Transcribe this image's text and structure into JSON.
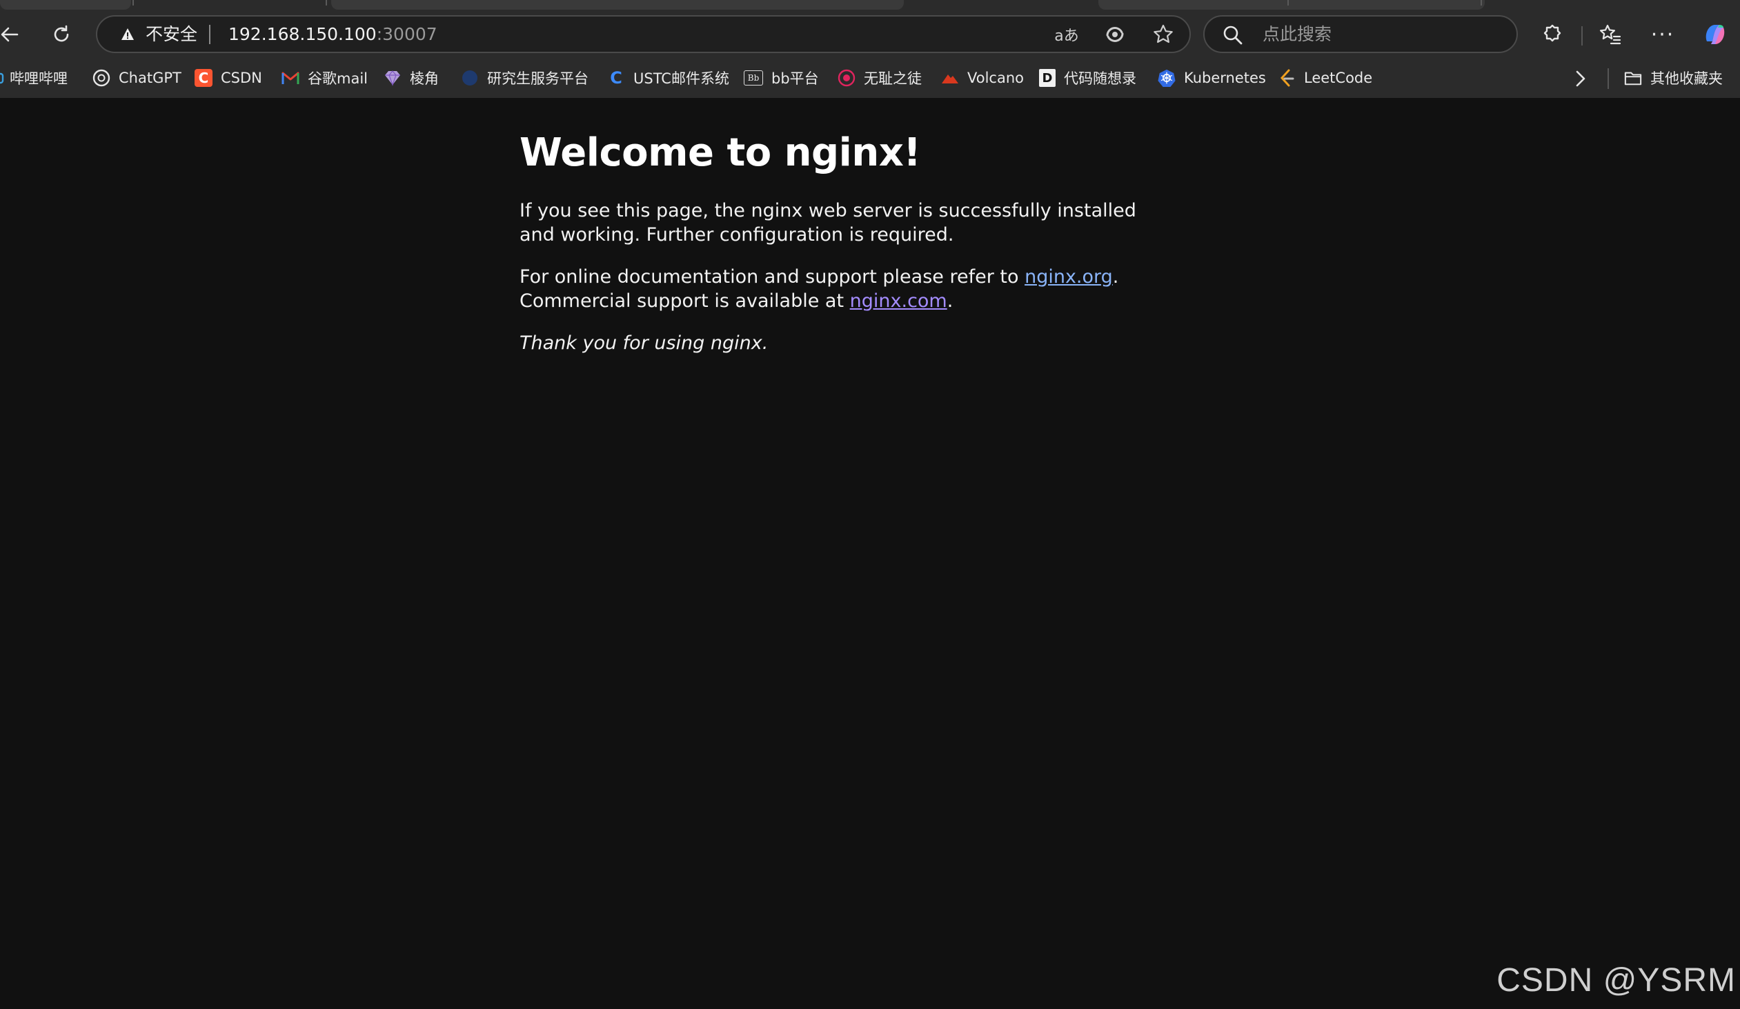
{
  "toolbar": {
    "security_label": "不安全",
    "url_host": "192.168.150.100",
    "url_port": ":30007",
    "search_placeholder": "点此搜索"
  },
  "bookmarks": [
    {
      "label": "哔哩哔哩",
      "icon": "bilibili-icon"
    },
    {
      "label": "ChatGPT",
      "icon": "chatgpt-icon"
    },
    {
      "label": "CSDN",
      "icon": "csdn-icon"
    },
    {
      "label": "谷歌mail",
      "icon": "gmail-icon"
    },
    {
      "label": "棱角",
      "icon": "gem-icon"
    },
    {
      "label": "研究生服务平台",
      "icon": "globe-icon"
    },
    {
      "label": "USTC邮件系统",
      "icon": "ustc-icon"
    },
    {
      "label": "bb平台",
      "icon": "blackboard-icon"
    },
    {
      "label": "无耻之徒",
      "icon": "shameless-icon"
    },
    {
      "label": "Volcano",
      "icon": "volcano-icon"
    },
    {
      "label": "代码随想录",
      "icon": "code-icon"
    },
    {
      "label": "Kubernetes",
      "icon": "kubernetes-icon"
    },
    {
      "label": "LeetCode",
      "icon": "leetcode-icon"
    }
  ],
  "other_favorites_label": "其他收藏夹",
  "page": {
    "heading": "Welcome to nginx!",
    "para1": "If you see this page, the nginx web server is successfully installed and working. Further configuration is required.",
    "para2_before": "For online documentation and support please refer to ",
    "link1": "nginx.org",
    "para2_mid": ".",
    "para2_line2": "Commercial support is available at ",
    "link2": "nginx.com",
    "para2_end": ".",
    "thanks": "Thank you for using nginx."
  },
  "watermark": "CSDN @YSRM"
}
